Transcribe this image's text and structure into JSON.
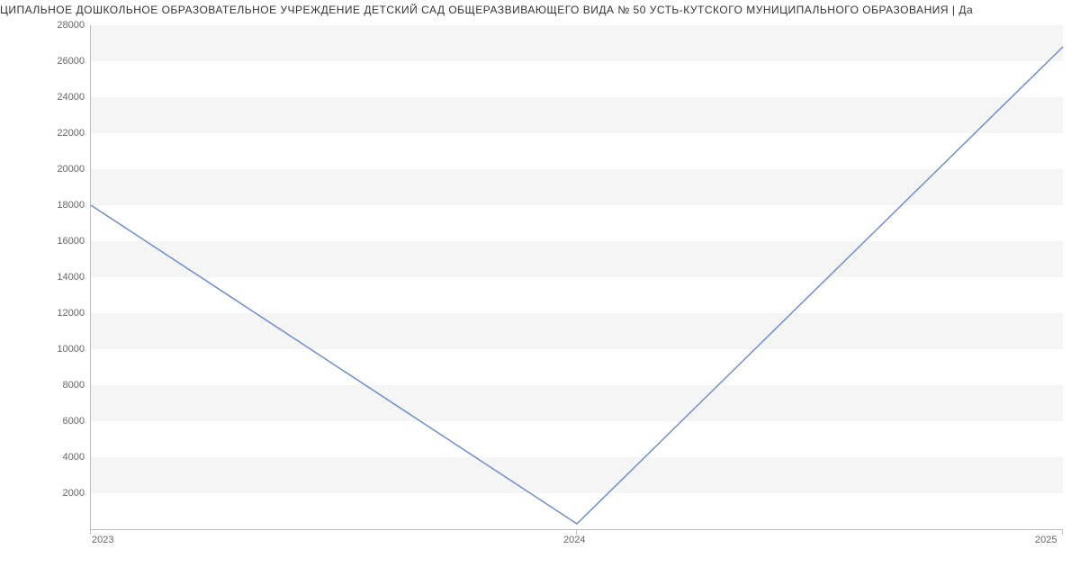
{
  "title": "ЦИПАЛЬНОЕ ДОШКОЛЬНОЕ ОБРАЗОВАТЕЛЬНОЕ УЧРЕЖДЕНИЕ ДЕТСКИЙ САД ОБЩЕРАЗВИВАЮЩЕГО ВИДА № 50 УСТЬ-КУТСКОГО МУНИЦИПАЛЬНОГО ОБРАЗОВАНИЯ | Да",
  "chart_data": {
    "type": "line",
    "x": [
      2023,
      2024,
      2025
    ],
    "values": [
      18000,
      300,
      26800
    ],
    "xlabel": "",
    "ylabel": "",
    "xlim": [
      2023,
      2025
    ],
    "ylim": [
      0,
      28000
    ],
    "xticks": [
      2023,
      2024,
      2025
    ],
    "yticks": [
      2000,
      4000,
      6000,
      8000,
      10000,
      12000,
      14000,
      16000,
      18000,
      20000,
      22000,
      24000,
      26000,
      28000
    ]
  }
}
